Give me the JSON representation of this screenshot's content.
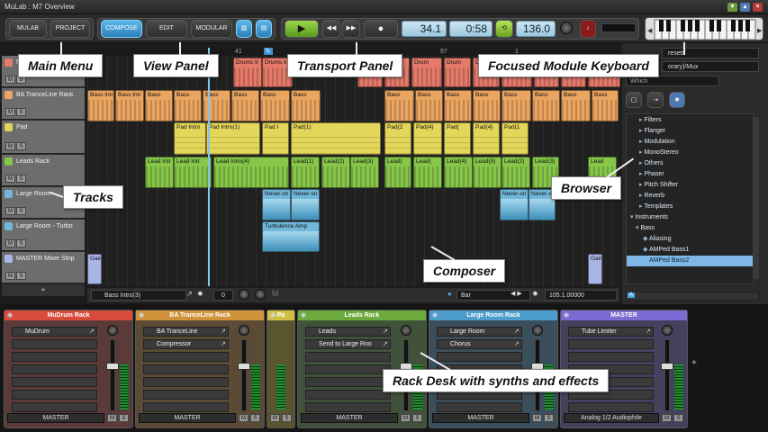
{
  "window": {
    "title": "MuLab : M7 Overview"
  },
  "menus": {
    "mulab": "MULAB",
    "project": "PROJECT"
  },
  "views": {
    "compose": "COMPOSE",
    "edit": "EDIT",
    "modular": "MODULAR"
  },
  "transport": {
    "bar": "34.1",
    "time": "0:58",
    "tempo": "136.0"
  },
  "ruler": {
    "m41": "41",
    "m97": "97",
    "m1": "1"
  },
  "tracks": [
    {
      "name": "MuDrum Rack",
      "color": "#e57a6a"
    },
    {
      "name": "BA TranceLine Rack",
      "color": "#eaa560"
    },
    {
      "name": "Pad",
      "color": "#e3d65a"
    },
    {
      "name": "Leads Rack",
      "color": "#86c648"
    },
    {
      "name": "Large Room",
      "color": "#70b7d9"
    },
    {
      "name": "Large Room - Turbo",
      "color": "#70b7d9"
    },
    {
      "name": "MASTER Mixer Strip",
      "color": "#a9b5e6"
    }
  ],
  "track_add": "+",
  "mute": "M",
  "solo": "S",
  "clips": {
    "drums": [
      "Drums Ir",
      "Drums In",
      "Drum",
      "Drum",
      "Drum",
      "Drum",
      "Drum",
      "Drum",
      "Drum",
      "Drum",
      "Drum"
    ],
    "bass": [
      "Bass Intr",
      "Bass Intr",
      "Bass",
      "Bass",
      "Bass",
      "Bass",
      "Bass",
      "Bass",
      "Bass",
      "Bass",
      "Bass",
      "Bass",
      "Bass",
      "Bass",
      "Bass",
      "Bass",
      "Bass",
      "Bass"
    ],
    "pad": [
      "Pad Intro",
      "Pad Intro(1)",
      "Pad I",
      "Pad(1)",
      "Pad(2",
      "Pad(4)",
      "Pad(",
      "Pad(4)",
      "Pad(1"
    ],
    "lead": [
      "Lead Intr",
      "Lead Intr",
      "Lead Intro(4)",
      "Lead(1)",
      "Lead(2)",
      "Lead(3)",
      "Lead(",
      "Lead(",
      "Lead(4)",
      "Lead(5)",
      "Lead(2)",
      "Lead(3)",
      "Lead"
    ],
    "room": [
      "Never-sn",
      "Never-sn",
      "Never-sn",
      "Never-s"
    ],
    "turbo": "Turbulence Amp",
    "gain": [
      "Gain",
      "Gain"
    ]
  },
  "composer_bottom": {
    "clip_name": "Bass Intro(3)",
    "num": "0",
    "snap": "Bar",
    "position": "105.1.00000"
  },
  "browser": {
    "tab_top": "resets",
    "path": "orary)/Mux",
    "which": "Which",
    "items": [
      "Filters",
      "Flanger",
      "Modulation",
      "MonoStereo",
      "Others",
      "Phaser",
      "Pitch Shifter",
      "Reverb",
      "Templates",
      "Instruments",
      "Bass",
      "Aliasing",
      "AMPed Bass1",
      "AMPed Bass2"
    ]
  },
  "rack": [
    {
      "name": "MuDrum Rack",
      "color": "#d84a3c",
      "body": "#5a3b39",
      "slots": [
        "MuDrum",
        "",
        "",
        "",
        "",
        "",
        ""
      ],
      "out": "MASTER"
    },
    {
      "name": "BA TranceLine Rack",
      "color": "#d1923c",
      "body": "#5b4a35",
      "slots": [
        "BA TranceLine",
        "Compressor",
        "",
        "",
        "",
        "",
        ""
      ],
      "out": "MASTER"
    },
    {
      "name": "Pa",
      "color": "#cfc044",
      "body": "#58552f",
      "slots": [
        "",
        "",
        "",
        "",
        "",
        "",
        ""
      ],
      "out": ""
    },
    {
      "name": "Leads Rack",
      "color": "#6daa3d",
      "body": "#40523a",
      "slots": [
        "Leads",
        "Send to Large Roo",
        "",
        "",
        "",
        "",
        ""
      ],
      "out": "MASTER"
    },
    {
      "name": "Large Room Rack",
      "color": "#4c9ccc",
      "body": "#3a4e5b",
      "slots": [
        "Large Room",
        "Chorus",
        "",
        "",
        "",
        "",
        ""
      ],
      "out": "MASTER"
    },
    {
      "name": "MASTER",
      "color": "#7b6ad1",
      "body": "#44405e",
      "slots": [
        "Tube Limiter",
        "",
        "",
        "",
        "",
        "",
        ""
      ],
      "out": "Analog 1/2 Audiophile"
    }
  ],
  "rack_add": "+",
  "annotations": {
    "main_menu": "Main Menu",
    "view_panel": "View Panel",
    "transport_panel": "Transport Panel",
    "keyboard": "Focused Module Keyboard",
    "tracks": "Tracks",
    "browser": "Browser",
    "composer": "Composer",
    "rack_desk": "Rack Desk with synths and effects"
  }
}
